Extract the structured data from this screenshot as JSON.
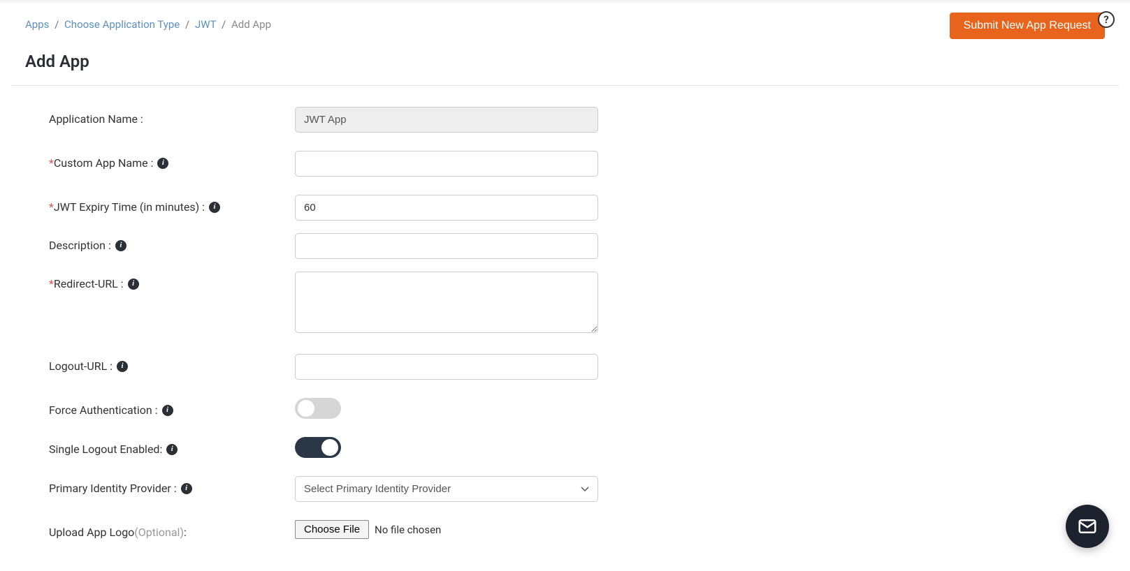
{
  "breadcrumb": {
    "items": [
      "Apps",
      "Choose Application Type",
      "JWT"
    ],
    "current": "Add App"
  },
  "header": {
    "submit_label": "Submit New App Request",
    "title": "Add App"
  },
  "form": {
    "app_name_label": "Application Name :",
    "app_name_value": "JWT App",
    "custom_name_label": "Custom App Name :",
    "custom_name_value": "",
    "expiry_label": "JWT Expiry Time (in minutes) :",
    "expiry_value": "60",
    "description_label": "Description :",
    "description_value": "",
    "redirect_label": "Redirect-URL :",
    "redirect_value": "",
    "logout_label": "Logout-URL :",
    "logout_value": "",
    "force_auth_label": "Force Authentication :",
    "single_logout_label": "Single Logout Enabled:",
    "idp_label": "Primary Identity Provider :",
    "idp_placeholder": "Select Primary Identity Provider",
    "upload_label": "Upload App Logo ",
    "upload_optional": "(Optional)",
    "upload_colon": ":",
    "file_btn": "Choose File",
    "file_status": "No file chosen",
    "required_mark": "*"
  },
  "icons": {
    "info_glyph": "i",
    "help_glyph": "?"
  }
}
